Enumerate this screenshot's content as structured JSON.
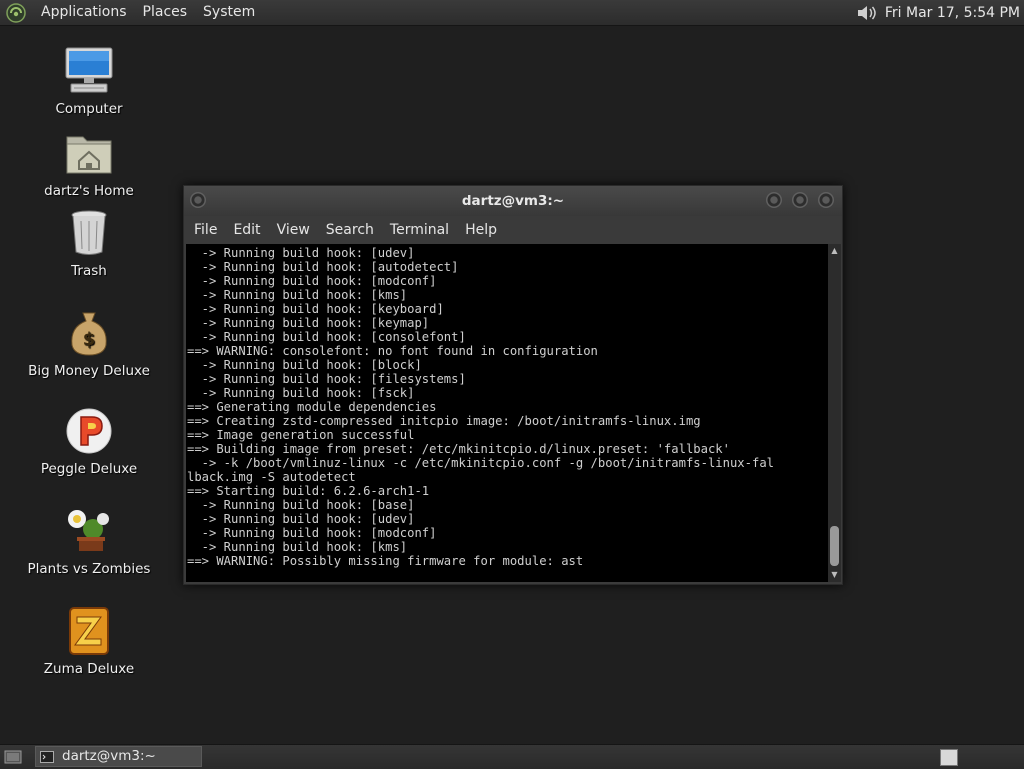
{
  "top_panel": {
    "menus": [
      "Applications",
      "Places",
      "System"
    ],
    "clock": "Fri Mar 17,  5:54 PM"
  },
  "desktop_icons": [
    {
      "label": "Computer",
      "icon": "computer-icon"
    },
    {
      "label": "dartz's Home",
      "icon": "home-folder-icon"
    },
    {
      "label": "Trash",
      "icon": "trash-icon"
    },
    {
      "label": "Big Money Deluxe",
      "icon": "money-bag-icon"
    },
    {
      "label": "Peggle Deluxe",
      "icon": "peggle-icon"
    },
    {
      "label": "Plants vs Zombies",
      "icon": "plants-vs-zombies-icon"
    },
    {
      "label": "Zuma Deluxe",
      "icon": "zuma-icon"
    }
  ],
  "terminal_window": {
    "title": "dartz@vm3:~",
    "menu": [
      "File",
      "Edit",
      "View",
      "Search",
      "Terminal",
      "Help"
    ],
    "lines": [
      "  -> Running build hook: [udev]",
      "  -> Running build hook: [autodetect]",
      "  -> Running build hook: [modconf]",
      "  -> Running build hook: [kms]",
      "  -> Running build hook: [keyboard]",
      "  -> Running build hook: [keymap]",
      "  -> Running build hook: [consolefont]",
      "==> WARNING: consolefont: no font found in configuration",
      "  -> Running build hook: [block]",
      "  -> Running build hook: [filesystems]",
      "  -> Running build hook: [fsck]",
      "==> Generating module dependencies",
      "==> Creating zstd-compressed initcpio image: /boot/initramfs-linux.img",
      "==> Image generation successful",
      "==> Building image from preset: /etc/mkinitcpio.d/linux.preset: 'fallback'",
      "  -> -k /boot/vmlinuz-linux -c /etc/mkinitcpio.conf -g /boot/initramfs-linux-fal",
      "lback.img -S autodetect",
      "==> Starting build: 6.2.6-arch1-1",
      "  -> Running build hook: [base]",
      "  -> Running build hook: [udev]",
      "  -> Running build hook: [modconf]",
      "  -> Running build hook: [kms]",
      "==> WARNING: Possibly missing firmware for module: ast"
    ]
  },
  "taskbar": {
    "task_label": "dartz@vm3:~"
  }
}
